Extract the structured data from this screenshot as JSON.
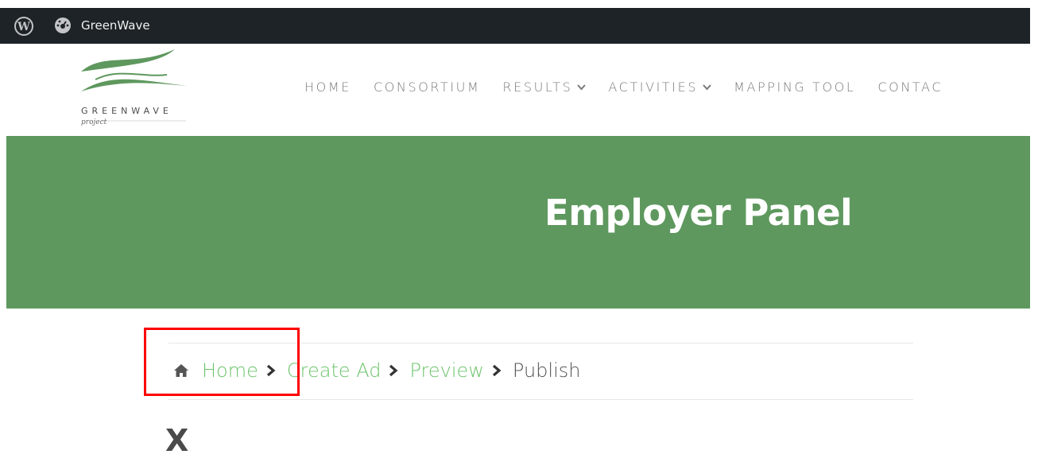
{
  "adminbar": {
    "site_name": "GreenWave",
    "icons": [
      "wordpress-icon",
      "dashboard-icon"
    ]
  },
  "logo": {
    "wordmark": "GREENWAVE",
    "subtext": "project"
  },
  "nav": {
    "items": [
      {
        "label": "HOME",
        "has_dropdown": false
      },
      {
        "label": "CONSORTIUM",
        "has_dropdown": false
      },
      {
        "label": "RESULTS",
        "has_dropdown": true
      },
      {
        "label": "ACTIVITIES",
        "has_dropdown": true
      },
      {
        "label": "MAPPING TOOL",
        "has_dropdown": false
      },
      {
        "label": "CONTAC",
        "has_dropdown": false
      }
    ]
  },
  "hero": {
    "title": "Employer Panel"
  },
  "breadcrumb": {
    "items": [
      {
        "label": "Home",
        "link": true
      },
      {
        "label": "Create Ad",
        "link": true
      },
      {
        "label": "Preview",
        "link": true
      },
      {
        "label": "Publish",
        "link": false
      }
    ]
  },
  "close_label": "X",
  "colors": {
    "adminbar_bg": "#1d2327",
    "hero_bg": "#5e985e",
    "link_green": "#6cc36c",
    "highlight_red": "#ff0000"
  }
}
